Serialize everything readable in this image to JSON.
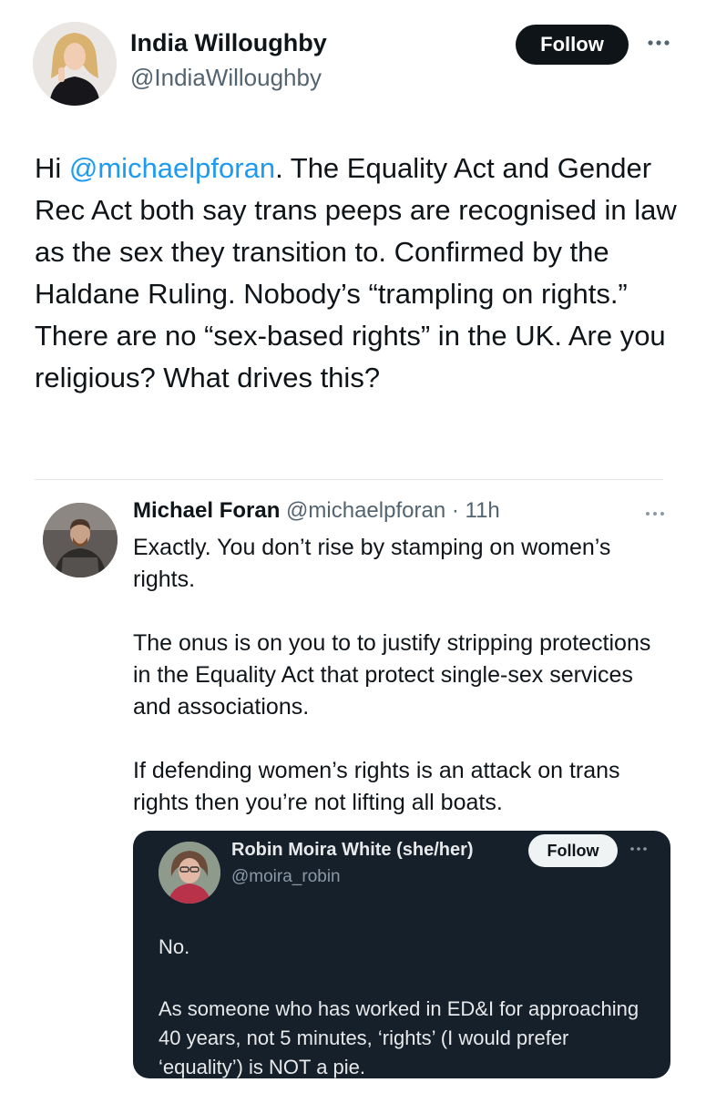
{
  "main_tweet": {
    "author_name": "India Willoughby",
    "author_handle": "@IndiaWilloughby",
    "follow_label": "Follow",
    "more_icon": "more-horizontal-icon",
    "text_prefix": "Hi ",
    "mention": "@michaelpforan",
    "text_body": ". The Equality Act and Gender Rec Act both say trans peeps are recognised in law as the sex they transition to. Confirmed by the Haldane Ruling. Nobody’s “trampling on rights.” There are no “sex-based rights” in the UK. Are you religious? What drives this?"
  },
  "quoted_tweet": {
    "author_name": "Michael Foran",
    "author_handle": "@michaelpforan",
    "separator": "·",
    "timestamp": "11h",
    "paragraphs": [
      "Exactly. You don’t rise by stamping on women’s rights.",
      "The onus is on you to to justify stripping protections in the Equality Act that protect single-sex services and associations.",
      "If defending women’s rights is an attack on trans rights then you’re not lifting all boats."
    ]
  },
  "nested_tweet": {
    "author_name": "Robin Moira White (she/her)",
    "author_handle": "@moira_robin",
    "follow_label": "Follow",
    "paragraphs": [
      "No.",
      "As someone who has worked in ED&I for approaching 40 years, not 5 minutes, ‘rights’ (I would prefer ‘equality’) is NOT a pie."
    ]
  },
  "colors": {
    "link": "#1d9bf0",
    "secondary_text": "#536471",
    "dark_card_bg": "#15202b",
    "follow_bg": "#0f1419"
  }
}
